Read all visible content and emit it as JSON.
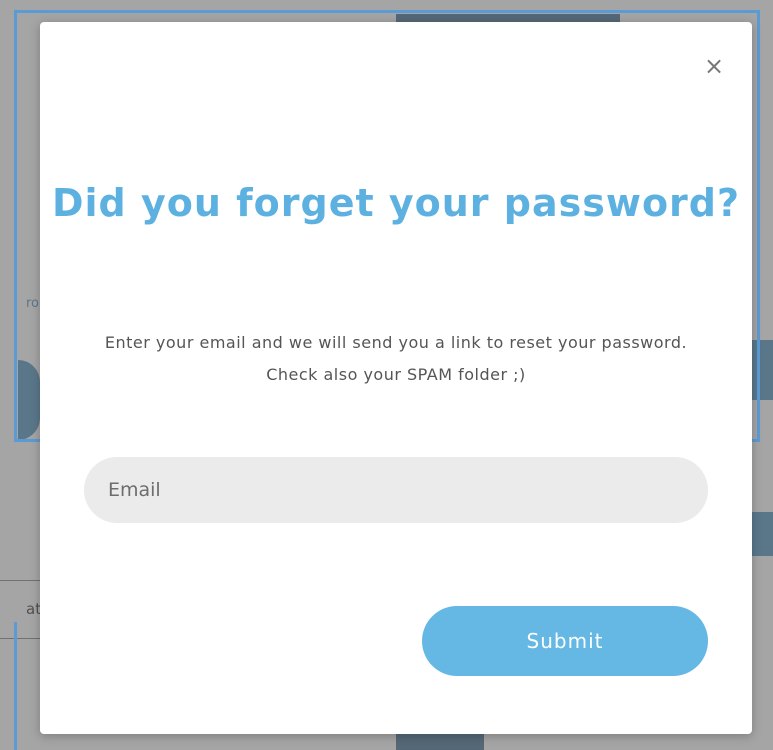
{
  "modal": {
    "close_symbol": "×",
    "title": "Did you forget your password?",
    "description": "Enter your email and we will send you a link to reset your password. Check also your SPAM folder ;)",
    "email_placeholder": "Email",
    "email_value": "",
    "submit_label": "Submit"
  },
  "background": {
    "partial_text_left": "ro",
    "partial_text_left2": "at"
  },
  "colors": {
    "accent": "#5db1e0",
    "button": "#66b8e4",
    "input_bg": "#ebebeb",
    "frame_outline": "#5b9bd5"
  },
  "icons": {
    "close": "close-icon"
  }
}
